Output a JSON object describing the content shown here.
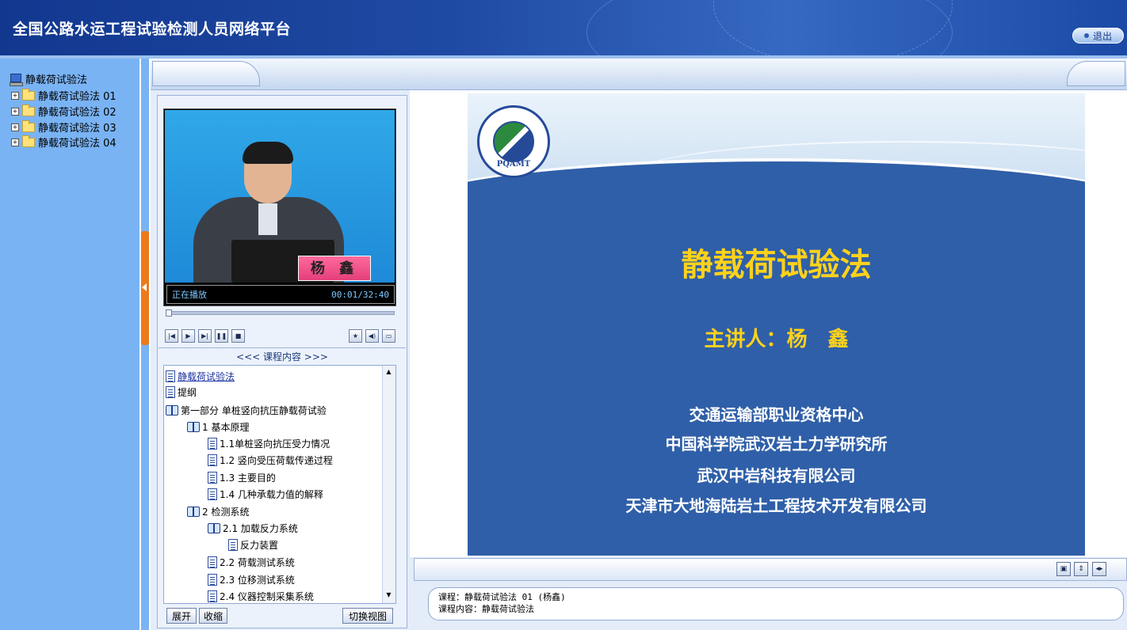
{
  "header": {
    "site_title": "全国公路水运工程试验检测人员网络平台",
    "logout_label": "退出"
  },
  "sidebar": {
    "root_label": "静载荷试验法",
    "items": [
      {
        "label": "静载荷试验法 01"
      },
      {
        "label": "静载荷试验法 02"
      },
      {
        "label": "静载荷试验法 03"
      },
      {
        "label": "静载荷试验法 04"
      }
    ]
  },
  "player": {
    "name_tag": "杨 鑫",
    "status": "正在播放",
    "time": "00:01/32:40",
    "progress_fraction": 0.0005
  },
  "outline": {
    "title": "<<< 课程内容 >>>",
    "items": [
      {
        "label": "静载荷试验法",
        "icon": "doc-icon"
      },
      {
        "label": "提纲",
        "icon": "doc-icon"
      },
      {
        "label": "第一部分 单桩竖向抗压静载荷试验",
        "icon": "book-icon"
      },
      {
        "label": "1 基本原理",
        "icon": "book-icon"
      },
      {
        "label": "1.1单桩竖向抗压受力情况",
        "icon": "doc-icon"
      },
      {
        "label": "1.2 竖向受压荷载传递过程",
        "icon": "doc-icon"
      },
      {
        "label": "1.3 主要目的",
        "icon": "doc-icon"
      },
      {
        "label": "1.4 几种承载力值的解释",
        "icon": "doc-icon"
      },
      {
        "label": "2 检测系统",
        "icon": "book-icon"
      },
      {
        "label": "2.1 加载反力系统",
        "icon": "book-icon"
      },
      {
        "label": "反力装置",
        "icon": "doc-icon"
      },
      {
        "label": "2.2 荷载测试系统",
        "icon": "doc-icon"
      },
      {
        "label": "2.3 位移测试系统",
        "icon": "doc-icon"
      },
      {
        "label": "2.4 仪器控制采集系统",
        "icon": "doc-icon"
      }
    ],
    "expand_label": "展开",
    "collapse_label": "收缩",
    "switch_view_label": "切换视图"
  },
  "slide": {
    "logo_text": "PQAMT",
    "title": "静载荷试验法",
    "presenter": "主讲人：杨　鑫",
    "orgs": [
      "交通运输部职业资格中心",
      "中国科学院武汉岩土力学研究所",
      "武汉中岩科技有限公司",
      "天津市大地海陆岩土工程技术开发有限公司"
    ]
  },
  "info": {
    "course_line": "课程：静载荷试验法 01 (杨鑫)",
    "content_line": "课程内容：静载荷试验法"
  }
}
